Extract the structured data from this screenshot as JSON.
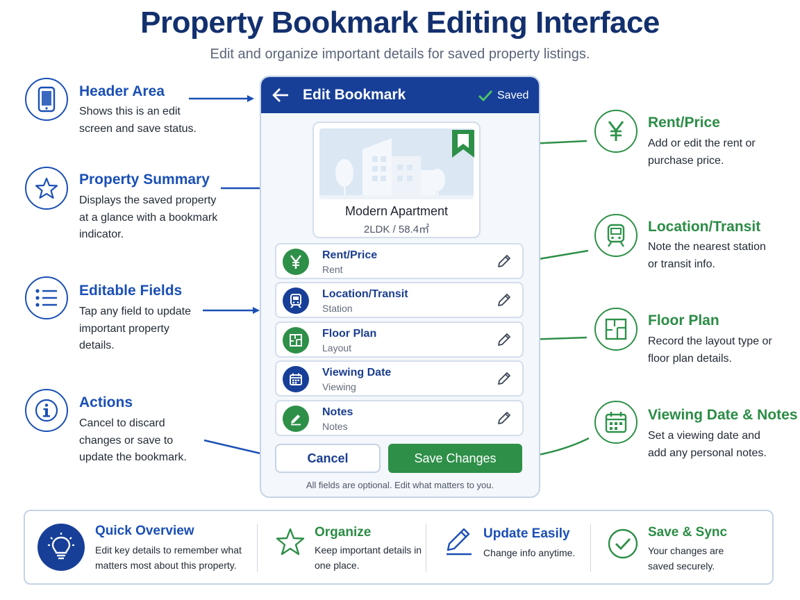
{
  "header": {
    "title": "Property Bookmark Editing Interface",
    "subtitle": "Edit and organize important details for saved property listings."
  },
  "left_annotations": [
    {
      "icon": "smartphone-icon",
      "title": "Header Area",
      "desc": "Shows this is an edit screen and save status."
    },
    {
      "icon": "star-icon",
      "title": "Property Summary",
      "desc": "Displays the saved property at a glance with a bookmark indicator."
    },
    {
      "icon": "list-icon",
      "title": "Editable Fields",
      "desc": "Tap any field to update important property details."
    },
    {
      "icon": "info-icon",
      "title": "Actions",
      "desc": "Cancel to discard changes or save to update the bookmark."
    }
  ],
  "right_annotations": [
    {
      "icon": "yen-icon",
      "title": "Rent/Price",
      "desc": "Add or edit the rent or purchase price."
    },
    {
      "icon": "train-icon",
      "title": "Location/Transit",
      "desc": "Note the nearest station or transit info."
    },
    {
      "icon": "floor-plan-icon",
      "title": "Floor Plan",
      "desc": "Record the layout type or floor plan details."
    },
    {
      "icon": "calendar-icon",
      "title": "Viewing Date & Notes",
      "desc": "Set a viewing date and add any personal notes."
    }
  ],
  "phone": {
    "title": "Edit Bookmark",
    "status": "Saved",
    "property": {
      "name": "Modern Apartment",
      "meta": "2LDK / 58.4㎡"
    },
    "fields": [
      {
        "icon": "yen-icon",
        "label": "Rent/Price",
        "sub": "Rent"
      },
      {
        "icon": "train-icon",
        "label": "Location/Transit",
        "sub": "Station"
      },
      {
        "icon": "floor-plan-icon",
        "label": "Floor Plan",
        "sub": "Layout"
      },
      {
        "icon": "calendar-icon",
        "label": "Viewing Date",
        "sub": "Viewing"
      },
      {
        "icon": "pencil-icon",
        "label": "Notes",
        "sub": "Notes"
      }
    ],
    "cancel_label": "Cancel",
    "save_label": "Save Changes",
    "footer": "All fields are optional. Edit what matters to you."
  },
  "bottom": [
    {
      "icon": "lightbulb-icon",
      "title": "Quick Overview",
      "desc": "Edit key details to remember what matters most about this property."
    },
    {
      "icon": "star-icon",
      "title": "Organize",
      "desc": "Keep important details in one place."
    },
    {
      "icon": "pencil-icon",
      "title": "Update Easily",
      "desc": "Change info anytime."
    },
    {
      "icon": "check-circle-icon",
      "title": "Save & Sync",
      "desc": "Your changes are saved securely."
    }
  ],
  "colors": {
    "brand_blue": "#173f98",
    "accent_blue": "#1a4fb5",
    "accent_green": "#2e8f48"
  }
}
